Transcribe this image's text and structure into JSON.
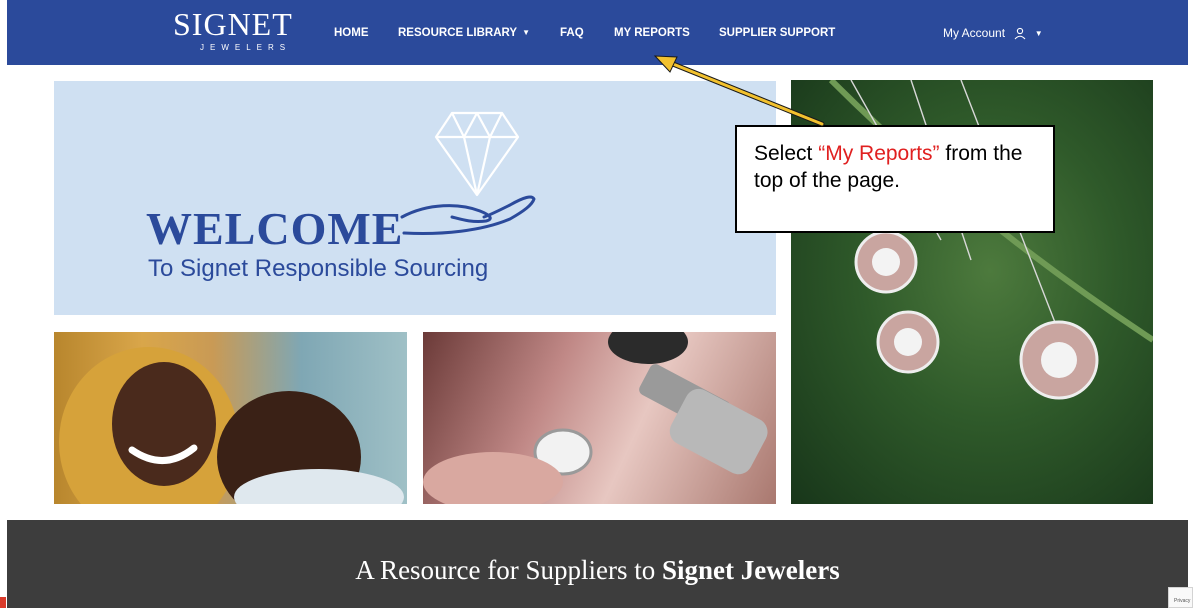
{
  "brand": {
    "name": "SIGNET",
    "tagline": "JEWELERS"
  },
  "nav": {
    "items": [
      {
        "label": "HOME"
      },
      {
        "label": "RESOURCE LIBRARY",
        "dropdown": true
      },
      {
        "label": "FAQ"
      },
      {
        "label": "MY REPORTS"
      },
      {
        "label": "SUPPLIER SUPPORT"
      }
    ],
    "account": {
      "label": "My Account",
      "icon": "user-icon"
    }
  },
  "hero": {
    "welcome_title": "WELCOME",
    "welcome_subtitle": "To Signet Responsible Sourcing"
  },
  "callout": {
    "prefix": "Select ",
    "highlight": "“My Reports”",
    "suffix": " from the top of the page."
  },
  "footer": {
    "text_prefix": "A Resource for Suppliers to ",
    "text_bold": "Signet Jewelers"
  },
  "recaptcha": {
    "label": "Privacy"
  },
  "colors": {
    "nav_bg": "#2b4a9b",
    "welcome_bg": "#cfe0f2",
    "footer_bg": "#3d3d3d",
    "arrow": "#f2c12e",
    "callout_highlight": "#e02020"
  }
}
